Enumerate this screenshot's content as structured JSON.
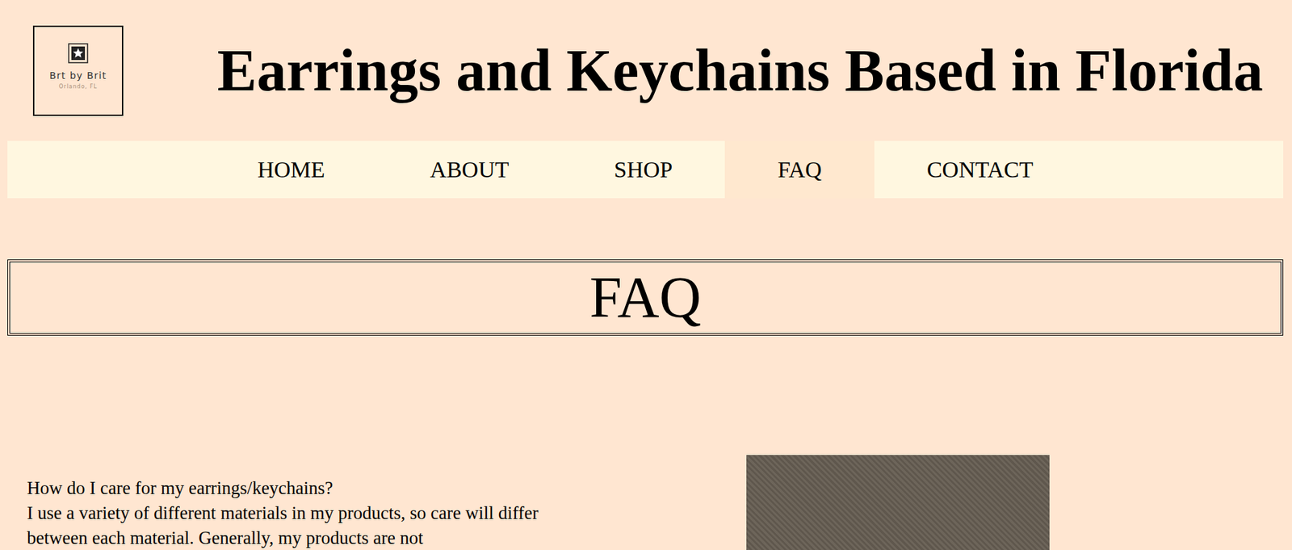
{
  "logo": {
    "name": "Brt by Brit",
    "location": "Orlando, FL"
  },
  "title": "Earrings and Keychains Based in Florida",
  "nav": [
    {
      "label": "HOME",
      "selected": false
    },
    {
      "label": "ABOUT",
      "selected": false
    },
    {
      "label": "SHOP",
      "selected": false
    },
    {
      "label": "FAQ",
      "selected": true
    },
    {
      "label": "CONTACT",
      "selected": false
    }
  ],
  "heading": "FAQ",
  "faq": [
    {
      "question": "How do I care for my earrings/keychains?",
      "answer": "I use a variety of different materials in my products, so care will differ between each material. Generally, my products are not"
    }
  ]
}
